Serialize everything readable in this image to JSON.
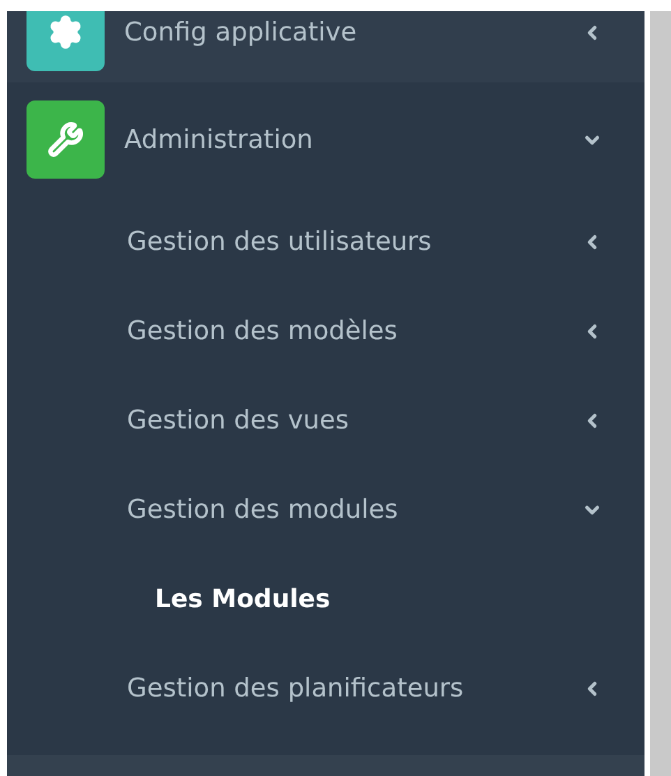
{
  "sidebar": {
    "items": [
      {
        "label": "Config applicative",
        "color": "#3fbdb3",
        "expanded": false,
        "selected": false
      },
      {
        "label": "Administration",
        "color": "#3cb54a",
        "expanded": true,
        "selected": false,
        "children": [
          {
            "label": "Gestion des utilisateurs",
            "expanded": false,
            "selected": false
          },
          {
            "label": "Gestion des modèles",
            "expanded": false,
            "selected": false
          },
          {
            "label": "Gestion des vues",
            "expanded": false,
            "selected": false
          },
          {
            "label": "Gestion des modules",
            "expanded": true,
            "selected": false,
            "children": [
              {
                "label": "Les Modules",
                "selected": true
              }
            ]
          },
          {
            "label": "Gestion des planificateurs",
            "expanded": false,
            "selected": false
          }
        ]
      }
    ]
  }
}
